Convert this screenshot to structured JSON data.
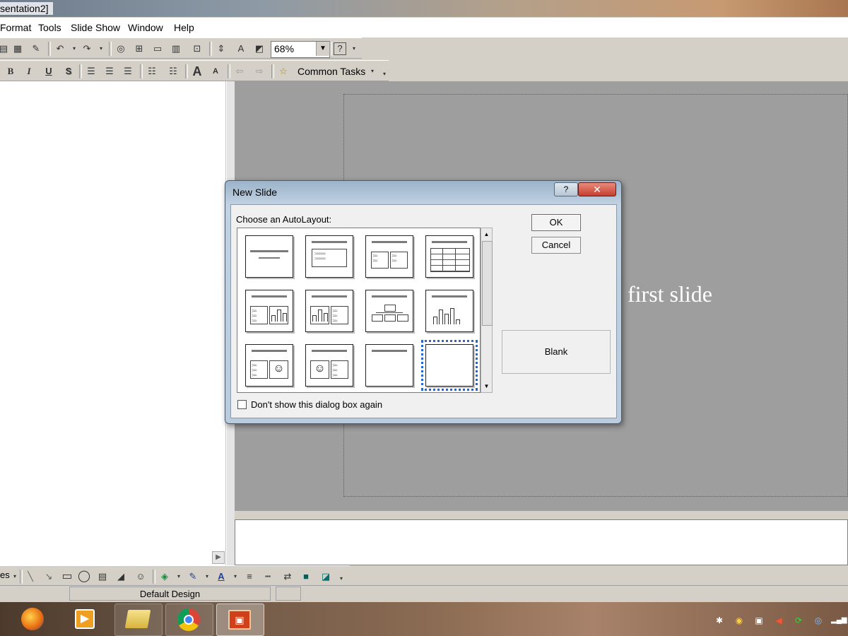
{
  "window": {
    "title": "sentation2]"
  },
  "menu": {
    "items": [
      {
        "id": "format",
        "label": "Format"
      },
      {
        "id": "tools",
        "label": "Tools"
      },
      {
        "id": "slideshow",
        "label": "Slide Show"
      },
      {
        "id": "window",
        "label": "Window"
      },
      {
        "id": "help",
        "label": "Help"
      }
    ]
  },
  "toolbar": {
    "zoom": "68%",
    "common_tasks": "Common Tasks",
    "bold": "B",
    "italic": "I",
    "underline": "U",
    "shadow": "S"
  },
  "slide": {
    "text": "first slide"
  },
  "drawing_toolbar": {
    "autoshapes_fragment": "es"
  },
  "status": {
    "design": "Default Design"
  },
  "dialog": {
    "title": "New Slide",
    "prompt": "Choose an AutoLayout:",
    "ok": "OK",
    "cancel": "Cancel",
    "help_glyph": "?",
    "close_glyph": "✕",
    "preview_name": "Blank",
    "dont_show": "Don't show this dialog box again",
    "selected_layout": "Blank",
    "layouts": [
      "Title Slide",
      "Bulleted List",
      "2 Column Text",
      "Table",
      "Text & Chart",
      "Chart & Text",
      "Organization Chart",
      "Chart",
      "Text & Clip Art",
      "Clip Art & Text",
      "Title Only",
      "Blank"
    ]
  },
  "colors": {
    "workspace": "#9e9e9e",
    "selection": "#2a66c9",
    "close_button": "#c4402e"
  }
}
